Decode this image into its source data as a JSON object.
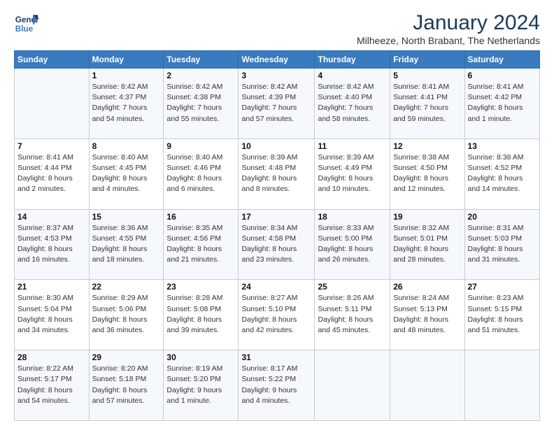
{
  "logo": {
    "line1": "General",
    "line2": "Blue"
  },
  "title": "January 2024",
  "location": "Milheeze, North Brabant, The Netherlands",
  "days_header": [
    "Sunday",
    "Monday",
    "Tuesday",
    "Wednesday",
    "Thursday",
    "Friday",
    "Saturday"
  ],
  "weeks": [
    [
      {
        "day": "",
        "info": ""
      },
      {
        "day": "1",
        "info": "Sunrise: 8:42 AM\nSunset: 4:37 PM\nDaylight: 7 hours\nand 54 minutes."
      },
      {
        "day": "2",
        "info": "Sunrise: 8:42 AM\nSunset: 4:38 PM\nDaylight: 7 hours\nand 55 minutes."
      },
      {
        "day": "3",
        "info": "Sunrise: 8:42 AM\nSunset: 4:39 PM\nDaylight: 7 hours\nand 57 minutes."
      },
      {
        "day": "4",
        "info": "Sunrise: 8:42 AM\nSunset: 4:40 PM\nDaylight: 7 hours\nand 58 minutes."
      },
      {
        "day": "5",
        "info": "Sunrise: 8:41 AM\nSunset: 4:41 PM\nDaylight: 7 hours\nand 59 minutes."
      },
      {
        "day": "6",
        "info": "Sunrise: 8:41 AM\nSunset: 4:42 PM\nDaylight: 8 hours\nand 1 minute."
      }
    ],
    [
      {
        "day": "7",
        "info": "Sunrise: 8:41 AM\nSunset: 4:44 PM\nDaylight: 8 hours\nand 2 minutes."
      },
      {
        "day": "8",
        "info": "Sunrise: 8:40 AM\nSunset: 4:45 PM\nDaylight: 8 hours\nand 4 minutes."
      },
      {
        "day": "9",
        "info": "Sunrise: 8:40 AM\nSunset: 4:46 PM\nDaylight: 8 hours\nand 6 minutes."
      },
      {
        "day": "10",
        "info": "Sunrise: 8:39 AM\nSunset: 4:48 PM\nDaylight: 8 hours\nand 8 minutes."
      },
      {
        "day": "11",
        "info": "Sunrise: 8:39 AM\nSunset: 4:49 PM\nDaylight: 8 hours\nand 10 minutes."
      },
      {
        "day": "12",
        "info": "Sunrise: 8:38 AM\nSunset: 4:50 PM\nDaylight: 8 hours\nand 12 minutes."
      },
      {
        "day": "13",
        "info": "Sunrise: 8:38 AM\nSunset: 4:52 PM\nDaylight: 8 hours\nand 14 minutes."
      }
    ],
    [
      {
        "day": "14",
        "info": "Sunrise: 8:37 AM\nSunset: 4:53 PM\nDaylight: 8 hours\nand 16 minutes."
      },
      {
        "day": "15",
        "info": "Sunrise: 8:36 AM\nSunset: 4:55 PM\nDaylight: 8 hours\nand 18 minutes."
      },
      {
        "day": "16",
        "info": "Sunrise: 8:35 AM\nSunset: 4:56 PM\nDaylight: 8 hours\nand 21 minutes."
      },
      {
        "day": "17",
        "info": "Sunrise: 8:34 AM\nSunset: 4:58 PM\nDaylight: 8 hours\nand 23 minutes."
      },
      {
        "day": "18",
        "info": "Sunrise: 8:33 AM\nSunset: 5:00 PM\nDaylight: 8 hours\nand 26 minutes."
      },
      {
        "day": "19",
        "info": "Sunrise: 8:32 AM\nSunset: 5:01 PM\nDaylight: 8 hours\nand 28 minutes."
      },
      {
        "day": "20",
        "info": "Sunrise: 8:31 AM\nSunset: 5:03 PM\nDaylight: 8 hours\nand 31 minutes."
      }
    ],
    [
      {
        "day": "21",
        "info": "Sunrise: 8:30 AM\nSunset: 5:04 PM\nDaylight: 8 hours\nand 34 minutes."
      },
      {
        "day": "22",
        "info": "Sunrise: 8:29 AM\nSunset: 5:06 PM\nDaylight: 8 hours\nand 36 minutes."
      },
      {
        "day": "23",
        "info": "Sunrise: 8:28 AM\nSunset: 5:08 PM\nDaylight: 8 hours\nand 39 minutes."
      },
      {
        "day": "24",
        "info": "Sunrise: 8:27 AM\nSunset: 5:10 PM\nDaylight: 8 hours\nand 42 minutes."
      },
      {
        "day": "25",
        "info": "Sunrise: 8:26 AM\nSunset: 5:11 PM\nDaylight: 8 hours\nand 45 minutes."
      },
      {
        "day": "26",
        "info": "Sunrise: 8:24 AM\nSunset: 5:13 PM\nDaylight: 8 hours\nand 48 minutes."
      },
      {
        "day": "27",
        "info": "Sunrise: 8:23 AM\nSunset: 5:15 PM\nDaylight: 8 hours\nand 51 minutes."
      }
    ],
    [
      {
        "day": "28",
        "info": "Sunrise: 8:22 AM\nSunset: 5:17 PM\nDaylight: 8 hours\nand 54 minutes."
      },
      {
        "day": "29",
        "info": "Sunrise: 8:20 AM\nSunset: 5:18 PM\nDaylight: 8 hours\nand 57 minutes."
      },
      {
        "day": "30",
        "info": "Sunrise: 8:19 AM\nSunset: 5:20 PM\nDaylight: 9 hours\nand 1 minute."
      },
      {
        "day": "31",
        "info": "Sunrise: 8:17 AM\nSunset: 5:22 PM\nDaylight: 9 hours\nand 4 minutes."
      },
      {
        "day": "",
        "info": ""
      },
      {
        "day": "",
        "info": ""
      },
      {
        "day": "",
        "info": ""
      }
    ]
  ]
}
